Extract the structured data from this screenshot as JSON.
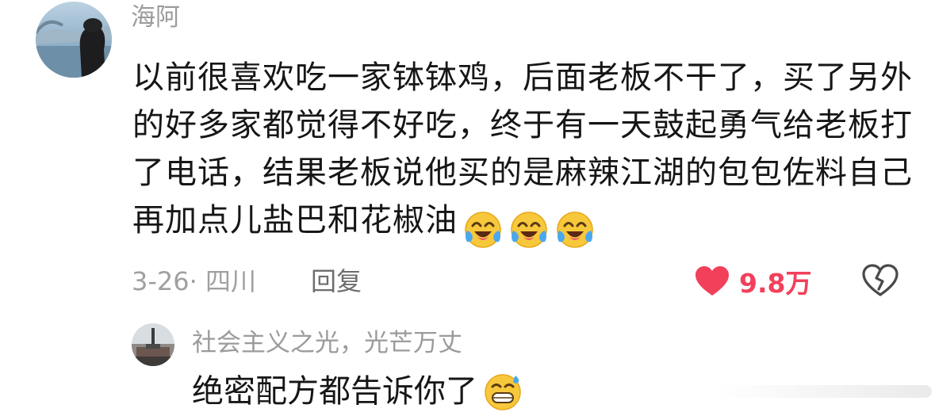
{
  "comment": {
    "username": "海阿",
    "text": "以前很喜欢吃一家钵钵鸡，后面老板不干了，买了另外的好多家都觉得不好吃，终于有一天鼓起勇气给老板打了电话，结果老板说他买的是麻辣江湖的包包佐料自己再加点儿盐巴和花椒油",
    "emojis": [
      "crying-laughing-emoji",
      "crying-laughing-emoji",
      "crying-laughing-emoji"
    ],
    "date_location": "3-26· 四川",
    "reply_label": "回复",
    "like_count": "9.8万",
    "like_color": "#f2405a"
  },
  "reply": {
    "username": "社会主义之光，光芒万丈",
    "text": "绝密配方都告诉你了",
    "emoji": "grin-sweat-emoji"
  },
  "icons": {
    "like": "heart-icon",
    "dislike": "broken-heart-icon"
  }
}
